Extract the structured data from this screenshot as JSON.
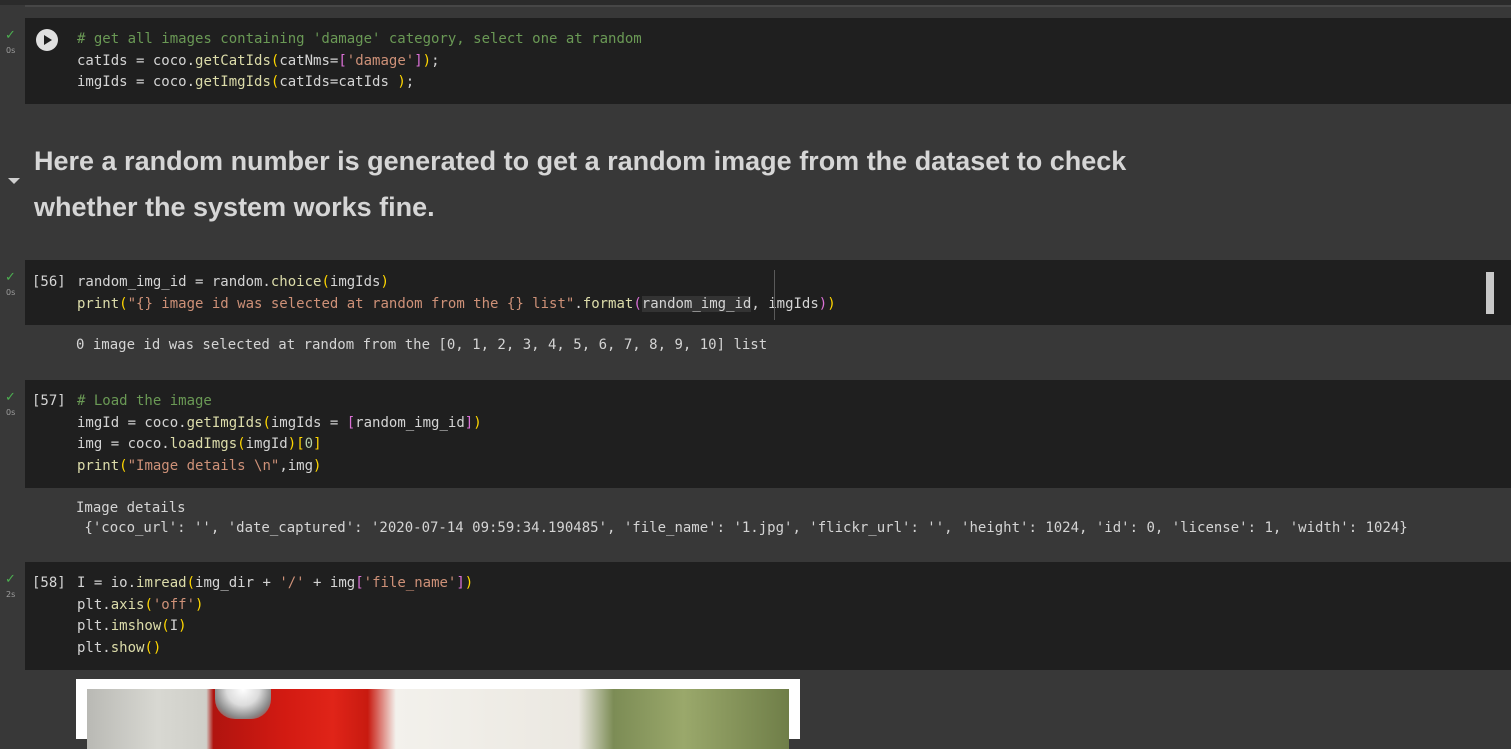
{
  "cells": [
    {
      "id": "cell-1",
      "status": "✓",
      "runtime": "0s",
      "lines": [
        [
          {
            "c": "cm",
            "t": "# get all images containing 'damage' category, select one at random"
          }
        ],
        [
          {
            "c": "var",
            "t": "catIds = coco."
          },
          {
            "c": "fn",
            "t": "getCatIds"
          },
          {
            "c": "br1",
            "t": "("
          },
          {
            "c": "var",
            "t": "catNms="
          },
          {
            "c": "br2",
            "t": "["
          },
          {
            "c": "st",
            "t": "'damage'"
          },
          {
            "c": "br2",
            "t": "]"
          },
          {
            "c": "br1",
            "t": ")"
          },
          {
            "c": "var",
            "t": ";"
          }
        ],
        [
          {
            "c": "var",
            "t": "imgIds = coco."
          },
          {
            "c": "fn",
            "t": "getImgIds"
          },
          {
            "c": "br1",
            "t": "("
          },
          {
            "c": "var",
            "t": "catIds=catIds "
          },
          {
            "c": "br1",
            "t": ")"
          },
          {
            "c": "var",
            "t": ";"
          }
        ]
      ]
    },
    {
      "id": "cell-56",
      "status": "✓",
      "runtime": "0s",
      "exec_count": "[56]",
      "lines": [
        [
          {
            "c": "var",
            "t": "random_img_id = random."
          },
          {
            "c": "fn",
            "t": "choice"
          },
          {
            "c": "br1",
            "t": "("
          },
          {
            "c": "var",
            "t": "imgIds"
          },
          {
            "c": "br1",
            "t": ")"
          }
        ],
        [
          {
            "c": "fn",
            "t": "print"
          },
          {
            "c": "br1",
            "t": "("
          },
          {
            "c": "st",
            "t": "\"{} image id was selected at random from the {} list\""
          },
          {
            "c": "var",
            "t": "."
          },
          {
            "c": "fn",
            "t": "format"
          },
          {
            "c": "br2",
            "t": "("
          },
          {
            "c": "hl",
            "t": "random_img_id"
          },
          {
            "c": "var",
            "t": ", imgIds"
          },
          {
            "c": "br2",
            "t": ")"
          },
          {
            "c": "br1",
            "t": ")"
          }
        ]
      ],
      "output": [
        "0 image id was selected at random from the [0, 1, 2, 3, 4, 5, 6, 7, 8, 9, 10] list"
      ]
    },
    {
      "id": "cell-57",
      "status": "✓",
      "runtime": "0s",
      "exec_count": "[57]",
      "lines": [
        [
          {
            "c": "cm",
            "t": "# Load the image"
          }
        ],
        [
          {
            "c": "var",
            "t": "imgId = coco."
          },
          {
            "c": "fn",
            "t": "getImgIds"
          },
          {
            "c": "br1",
            "t": "("
          },
          {
            "c": "var",
            "t": "imgIds = "
          },
          {
            "c": "br2",
            "t": "["
          },
          {
            "c": "var",
            "t": "random_img_id"
          },
          {
            "c": "br2",
            "t": "]"
          },
          {
            "c": "br1",
            "t": ")"
          }
        ],
        [
          {
            "c": "var",
            "t": "img = coco."
          },
          {
            "c": "fn",
            "t": "loadImgs"
          },
          {
            "c": "br1",
            "t": "("
          },
          {
            "c": "var",
            "t": "imgId"
          },
          {
            "c": "br1",
            "t": ")"
          },
          {
            "c": "br1",
            "t": "["
          },
          {
            "c": "num",
            "t": "0"
          },
          {
            "c": "br1",
            "t": "]"
          }
        ],
        [
          {
            "c": "fn",
            "t": "print"
          },
          {
            "c": "br1",
            "t": "("
          },
          {
            "c": "st",
            "t": "\"Image details \\n\""
          },
          {
            "c": "var",
            "t": ",img"
          },
          {
            "c": "br1",
            "t": ")"
          }
        ]
      ],
      "output": [
        "Image details",
        " {'coco_url': '', 'date_captured': '2020-07-14 09:59:34.190485', 'file_name': '1.jpg', 'flickr_url': '', 'height': 1024, 'id': 0, 'license': 1, 'width': 1024}"
      ]
    },
    {
      "id": "cell-58",
      "status": "✓",
      "runtime": "2s",
      "exec_count": "[58]",
      "lines": [
        [
          {
            "c": "var",
            "t": "I = io."
          },
          {
            "c": "fn",
            "t": "imread"
          },
          {
            "c": "br1",
            "t": "("
          },
          {
            "c": "var",
            "t": "img_dir + "
          },
          {
            "c": "st",
            "t": "'/'"
          },
          {
            "c": "var",
            "t": " + img"
          },
          {
            "c": "br2",
            "t": "["
          },
          {
            "c": "st",
            "t": "'file_name'"
          },
          {
            "c": "br2",
            "t": "]"
          },
          {
            "c": "br1",
            "t": ")"
          }
        ],
        [
          {
            "c": "var",
            "t": "plt."
          },
          {
            "c": "fn",
            "t": "axis"
          },
          {
            "c": "br1",
            "t": "("
          },
          {
            "c": "st",
            "t": "'off'"
          },
          {
            "c": "br1",
            "t": ")"
          }
        ],
        [
          {
            "c": "var",
            "t": "plt."
          },
          {
            "c": "fn",
            "t": "imshow"
          },
          {
            "c": "br1",
            "t": "("
          },
          {
            "c": "var",
            "t": "I"
          },
          {
            "c": "br1",
            "t": ")"
          }
        ],
        [
          {
            "c": "var",
            "t": "plt."
          },
          {
            "c": "fn",
            "t": "show"
          },
          {
            "c": "br1",
            "t": "()"
          }
        ]
      ]
    }
  ],
  "markdown": {
    "heading": "Here a random number is generated to get a random image from the dataset to check whether the system works fine."
  }
}
